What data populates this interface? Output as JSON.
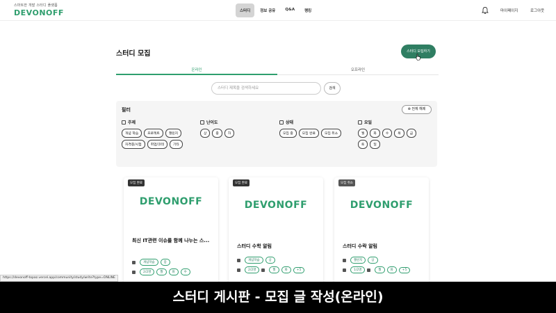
{
  "header": {
    "tagline": "스마트한 개발 스터디 플랫폼",
    "logo": "DEVONOFF",
    "nav": [
      "스터디",
      "정보 공유",
      "Q&A",
      "랭킹"
    ],
    "mypage": "마이페이지",
    "logout": "로그아웃"
  },
  "main": {
    "title": "스터디 모집",
    "write_button": "스터디 모집하기",
    "tabs": [
      "온라인",
      "오프라인"
    ],
    "search_placeholder": "스터디 제목을 검색하세요",
    "search_button": "검색"
  },
  "filter": {
    "title": "필터",
    "reset": "전체 해제",
    "groups": [
      {
        "label": "주제",
        "options": [
          "개념 학습",
          "프로젝트",
          "챌린지",
          "자격증/시험",
          "취업/코테",
          "기타"
        ]
      },
      {
        "label": "난이도",
        "options": [
          "상",
          "중",
          "하"
        ]
      },
      {
        "label": "상태",
        "options": [
          "모집 중",
          "모집 완료",
          "모집 취소"
        ]
      },
      {
        "label": "요일",
        "options": [
          "월",
          "화",
          "수",
          "목",
          "금",
          "토",
          "일"
        ]
      }
    ]
  },
  "cards": [
    {
      "badge": "모집 완료",
      "logo": "DEVONOFF",
      "title": "최신 IT관련 이슈를 함께 나누는 스...",
      "topic": "개념학습",
      "level": "중",
      "people": "2/2명",
      "days": [
        "월",
        "화",
        "수"
      ]
    },
    {
      "badge": "모집 완료",
      "logo": "DEVONOFF",
      "title": "스터디 수학 알림",
      "topic": "개념학습",
      "level": "상",
      "people": "2/2명",
      "days": [
        "월",
        "화",
        "+5"
      ]
    },
    {
      "badge": "모집 취소",
      "logo": "DEVONOFF",
      "title": "스터디 수락 알림",
      "topic": "챌린지",
      "level": "상",
      "people": "1/2명",
      "days": [
        "월",
        "화",
        "+5"
      ]
    }
  ],
  "status_url": "https://devonoff-topaz.vercel.app/community/study/write?type=ONLINE",
  "caption": "스터디 게시판 - 모집 글 작성(온라인)",
  "colors": {
    "accent": "#2f9e6e",
    "button": "#2f7e62"
  }
}
